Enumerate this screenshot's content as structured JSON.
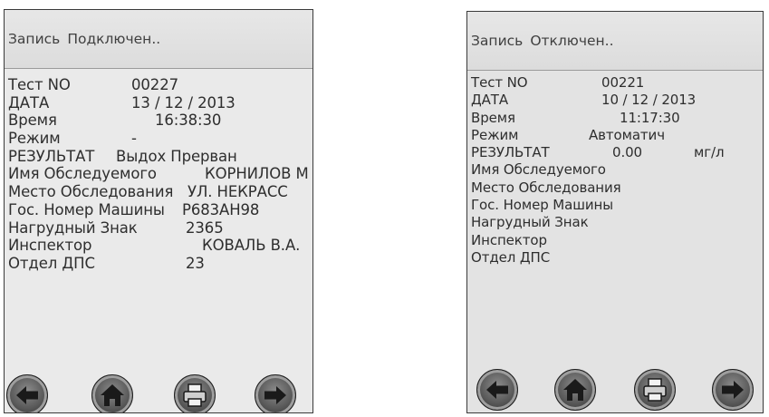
{
  "screens": [
    {
      "status": {
        "mode": "Запись",
        "connection": "Подключен.."
      },
      "rows": [
        {
          "label": "Тест NO",
          "value": "00227"
        },
        {
          "label": "ДАТА",
          "value": "13 / 12 / 2013"
        },
        {
          "label": "Время",
          "value": "16:38:30"
        },
        {
          "label": "Режим",
          "value": "-"
        },
        {
          "label": "РЕЗУЛЬТАТ",
          "value": "Выдох Прерван"
        },
        {
          "label": "Имя Обследуемого",
          "value": "КОРНИЛОВ М"
        },
        {
          "label": "Место Обследования",
          "value": "УЛ. НЕКРАСС"
        },
        {
          "label": "Гос. Номер Машины",
          "value": "Р683АН98"
        },
        {
          "label": "Нагрудный Знак",
          "value": "2365"
        },
        {
          "label": "Инспектор",
          "value": "КОВАЛЬ В.А."
        },
        {
          "label": "Отдел ДПС",
          "value": "23"
        }
      ],
      "buttons": [
        "back-arrow-icon",
        "home-icon",
        "printer-icon",
        "forward-arrow-icon"
      ]
    },
    {
      "status": {
        "mode": "Запись",
        "connection": "Отключен.."
      },
      "rows": [
        {
          "label": "Тест NO",
          "value": "00221"
        },
        {
          "label": "ДАТА",
          "value": "10 / 12 / 2013"
        },
        {
          "label": "Время",
          "value": "11:17:30"
        },
        {
          "label": "Режим",
          "value": "Автоматич"
        },
        {
          "label": "РЕЗУЛЬТАТ",
          "value": "0.00",
          "unit": "мг/л"
        },
        {
          "label": "Имя Обследуемого",
          "value": ""
        },
        {
          "label": "Место Обследования",
          "value": ""
        },
        {
          "label": "Гос. Номер Машины",
          "value": ""
        },
        {
          "label": "Нагрудный Знак",
          "value": ""
        },
        {
          "label": "Инспектор",
          "value": ""
        },
        {
          "label": "Отдел ДПС",
          "value": ""
        }
      ],
      "buttons": [
        "back-arrow-icon",
        "home-icon",
        "printer-icon",
        "forward-arrow-icon"
      ]
    }
  ]
}
